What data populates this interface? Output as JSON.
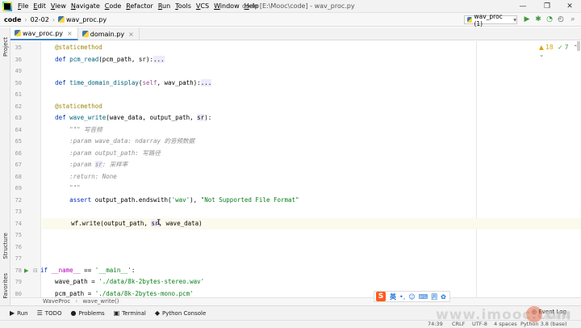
{
  "menubar": {
    "items": [
      {
        "mnemonic": "F",
        "rest": "ile"
      },
      {
        "mnemonic": "E",
        "rest": "dit"
      },
      {
        "mnemonic": "V",
        "rest": "iew"
      },
      {
        "mnemonic": "N",
        "rest": "avigate"
      },
      {
        "mnemonic": "C",
        "rest": "ode"
      },
      {
        "mnemonic": "R",
        "rest": "efactor"
      },
      {
        "mnemonic": "R",
        "rest": "un"
      },
      {
        "mnemonic": "T",
        "rest": "ools"
      },
      {
        "mnemonic": "V",
        "rest": "CS"
      },
      {
        "mnemonic": "W",
        "rest": "indow"
      },
      {
        "mnemonic": "H",
        "rest": "elp"
      }
    ],
    "window_title": "code [E:\\Mooc\\code] - wav_proc.py",
    "minimize": "—",
    "maximize": "❐",
    "close": "✕"
  },
  "navbar": {
    "crumbs": [
      "code",
      "02-02",
      "wav_proc.py"
    ],
    "separator": "›",
    "run_config": "wav_proc (1)",
    "run_config_arrow": "▾",
    "run_icon": "▶",
    "debug_icon": "✱",
    "coverage_icon": "◔",
    "profile_icon": "◴",
    "search_icon": "⌕"
  },
  "left_strip": {
    "top_tab": "Project",
    "structure_tab": "Structure",
    "favorites_tab": "Favorites"
  },
  "tabs": [
    {
      "label": "wav_proc.py",
      "active": true
    },
    {
      "label": "domain.py",
      "active": false
    }
  ],
  "editor": {
    "inspections_warnings": "▲ 18",
    "inspections_weak": "✓ 7",
    "inspections_arrows": "⌃ ⌄",
    "lines": [
      {
        "n": "35",
        "html": "    <span class=\"dec\">@staticmethod</span>"
      },
      {
        "n": "36",
        "html": "    <span class=\"kw\">def</span> <span class=\"fn\">pcm_read</span>(pcm_path, sr):<span class=\"hl\">...</span>"
      },
      {
        "n": "49",
        "html": ""
      },
      {
        "n": "50",
        "html": "    <span class=\"kw\">def</span> <span class=\"fn\">time_domain_display</span>(<span class=\"self\">self</span>, wav_path):<span class=\"hl\">...</span>"
      },
      {
        "n": "61",
        "html": ""
      },
      {
        "n": "62",
        "html": "    <span class=\"dec\">@staticmethod</span>"
      },
      {
        "n": "63",
        "html": "    <span class=\"kw\">def</span> <span class=\"fn\">wave_write</span>(wave_data, output_path, <span class=\"hl\">sr</span>):"
      },
      {
        "n": "64",
        "html": "        <span class=\"doc\">\"\"\" 写音频</span>"
      },
      {
        "n": "65",
        "html": "        <span class=\"doc\">:param wave_data: ndarray 的音频数据</span>"
      },
      {
        "n": "66",
        "html": "        <span class=\"doc\">:param output_path: 写路径</span>"
      },
      {
        "n": "67",
        "html": "        <span class=\"doc\">:param </span><span class=\"doc hl\">sr</span><span class=\"doc\">: 采样率</span>"
      },
      {
        "n": "68",
        "html": "        <span class=\"doc\">:return: None</span>"
      },
      {
        "n": "69",
        "html": "        <span class=\"doc\">\"\"\"</span>"
      },
      {
        "n": "72",
        "html": "        <span class=\"kw\">assert</span> output_path.endswith(<span class=\"str\">'wav'</span>), <span class=\"str\">\"Not Supported File Format\"</span>"
      },
      {
        "n": "73",
        "html": ""
      },
      {
        "n": "74",
        "html": "        wf.write(output_path, <span class=\"hl\">sr</span>, wave_data)"
      },
      {
        "n": "75",
        "html": ""
      },
      {
        "n": "76",
        "html": ""
      },
      {
        "n": "77",
        "html": ""
      },
      {
        "n": "78",
        "html": "<span class=\"kw\">if</span> <span class=\"dunder\">__name__</span> == <span class=\"str\">'__main__'</span>:"
      },
      {
        "n": "79",
        "html": "    wave_path = <span class=\"str\">'./data/8k-2bytes-stereo.wav'</span>"
      },
      {
        "n": "80",
        "html": "    pcm_path = <span class=\"str\">'./data/8k-2bytes-mono.pcm'</span>"
      },
      {
        "n": "81",
        "html": "<span class=\"doc\">#</span>"
      }
    ],
    "current_line_index": 15,
    "bulb_icon": "💡",
    "run_marker_icon": "▶",
    "fold_icon": "⊟",
    "text_cursor": "I"
  },
  "status_breadcrumb": {
    "class_name": "WaveProc",
    "separator": "›",
    "method_name": "wave_write()"
  },
  "bottom_tools": [
    {
      "icon": "▶",
      "label": "Run"
    },
    {
      "icon": "☰",
      "label": "TODO"
    },
    {
      "icon": "●",
      "label": "Problems"
    },
    {
      "icon": "▣",
      "label": "Terminal"
    },
    {
      "icon": "◆",
      "label": "Python Console"
    }
  ],
  "event_log": "Event Log",
  "statusbar": {
    "position": "74:39",
    "line_sep": "CRLF",
    "encoding": "UTF-8",
    "indent": "4 spaces",
    "interpreter": "Python 3.8 (base)"
  },
  "ime": {
    "logo": "S",
    "lang": "英",
    "icons": [
      "•,",
      "☺",
      "⌨",
      "囲",
      "✿"
    ]
  },
  "watermark": {
    "text": "www.imooc.com",
    "badge": "慕课网"
  }
}
